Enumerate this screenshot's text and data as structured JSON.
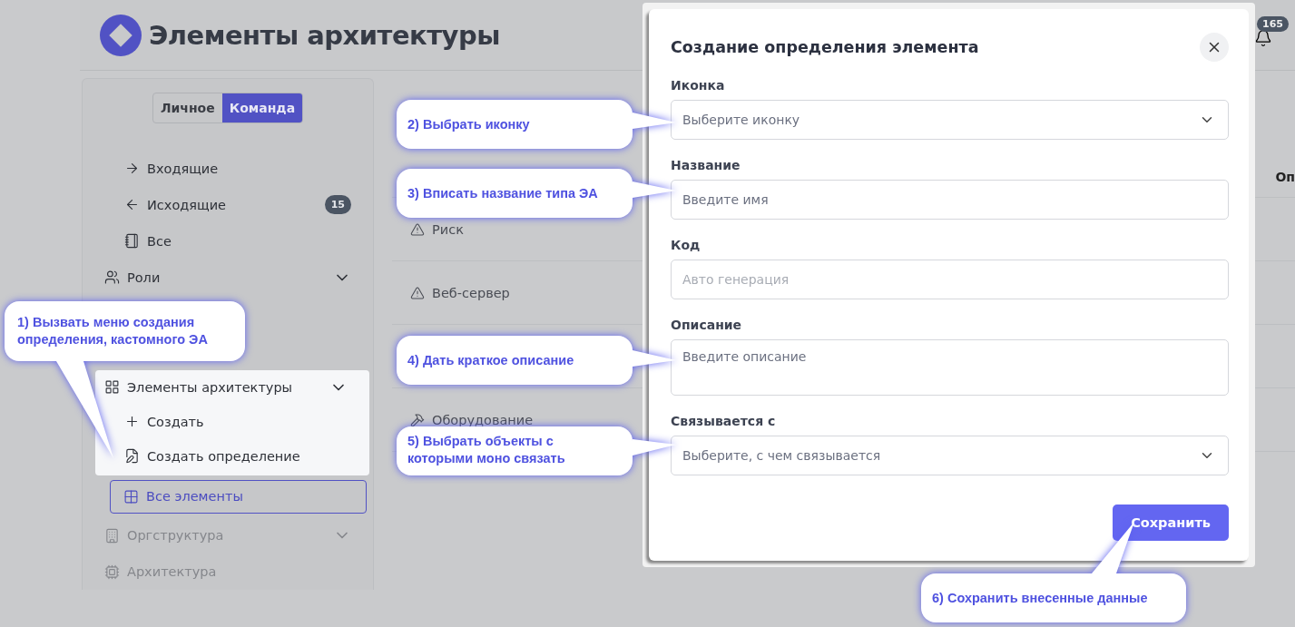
{
  "header": {
    "title": "Элементы архитектуры",
    "notifications": "165"
  },
  "sidebar": {
    "toggle": [
      {
        "label": "Личное",
        "selected": false
      },
      {
        "label": "Команда",
        "selected": true
      }
    ],
    "items": [
      {
        "label": "Входящие"
      },
      {
        "label": "Исходящие",
        "badge": "15"
      },
      {
        "label": "Все"
      },
      {
        "label": "Роли",
        "expanded": false
      }
    ],
    "menu": {
      "label": "Элементы архитектуры",
      "expanded": true,
      "children": [
        {
          "label": "Создать"
        },
        {
          "label": "Создать определение"
        }
      ]
    },
    "current": {
      "label": "Все элементы",
      "selected": true
    },
    "more": [
      {
        "label": "Оргструктура",
        "disabled": true,
        "expanded": false
      },
      {
        "label": "Архитектура",
        "disabled": true
      }
    ]
  },
  "table": {
    "column_2": "Оп",
    "rows": [
      {
        "name": "Риск"
      },
      {
        "name": "Веб-сервер"
      },
      {
        "name": ""
      },
      {
        "name": "Оборудование"
      }
    ]
  },
  "dialog": {
    "title": "Создание определения элемента",
    "fields": [
      {
        "label": "Иконка",
        "kind": "select",
        "placeholder": "Выберите иконку",
        "disabled": false
      },
      {
        "label": "Название",
        "kind": "input",
        "placeholder": "Введите имя",
        "disabled": false
      },
      {
        "label": "Код",
        "kind": "input",
        "placeholder": "Авто генерация",
        "disabled": true
      },
      {
        "label": "Описание",
        "kind": "textarea",
        "placeholder": "Введите описание",
        "disabled": false
      },
      {
        "label": "Связывается с",
        "kind": "select",
        "placeholder": "Выберите, с чем связывается",
        "disabled": false
      }
    ],
    "save": "Сохранить"
  },
  "callouts": [
    {
      "text": "1) Вызвать меню создания определения, кастомного ЭА"
    },
    {
      "text": "2) Выбрать иконку"
    },
    {
      "text": "3) Вписать название типа ЭА"
    },
    {
      "text": "4) Дать краткое описание"
    },
    {
      "text": "5) Выбрать объекты с которыми моно связать"
    },
    {
      "text": "6) Сохранить внесенные данные"
    }
  ]
}
